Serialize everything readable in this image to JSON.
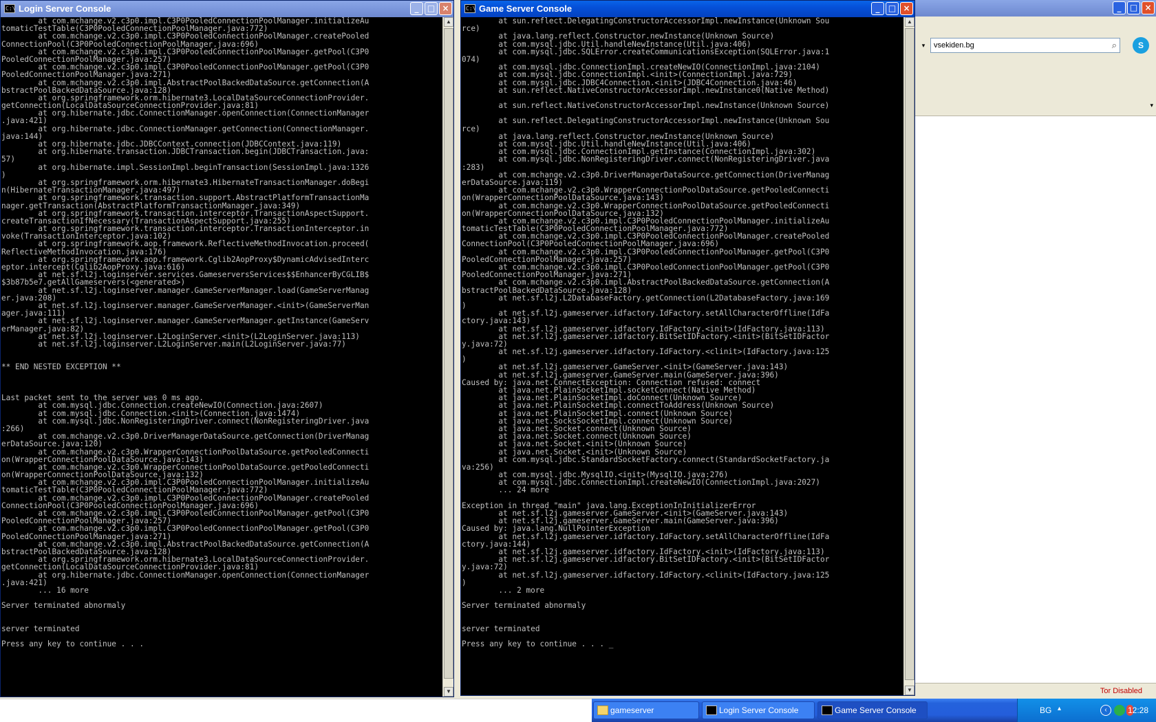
{
  "colors": {
    "title_active": "#0550d8",
    "console_bg": "#000000",
    "console_fg": "#c0c0c0",
    "tor_red": "#c00000"
  },
  "login_window": {
    "title": "Login Server Console",
    "icon": "cmd-icon",
    "lines": [
      "        at com.mchange.v2.c3p0.impl.C3P0PooledConnectionPoolManager.initializeAu",
      "tomaticTestTable(C3P0PooledConnectionPoolManager.java:772)",
      "        at com.mchange.v2.c3p0.impl.C3P0PooledConnectionPoolManager.createPooled",
      "ConnectionPool(C3P0PooledConnectionPoolManager.java:696)",
      "        at com.mchange.v2.c3p0.impl.C3P0PooledConnectionPoolManager.getPool(C3P0",
      "PooledConnectionPoolManager.java:257)",
      "        at com.mchange.v2.c3p0.impl.C3P0PooledConnectionPoolManager.getPool(C3P0",
      "PooledConnectionPoolManager.java:271)",
      "        at com.mchange.v2.c3p0.impl.AbstractPoolBackedDataSource.getConnection(A",
      "bstractPoolBackedDataSource.java:128)",
      "        at org.springframework.orm.hibernate3.LocalDataSourceConnectionProvider.",
      "getConnection(LocalDataSourceConnectionProvider.java:81)",
      "        at org.hibernate.jdbc.ConnectionManager.openConnection(ConnectionManager",
      ".java:421)",
      "        at org.hibernate.jdbc.ConnectionManager.getConnection(ConnectionManager.",
      "java:144)",
      "        at org.hibernate.jdbc.JDBCContext.connection(JDBCContext.java:119)",
      "        at org.hibernate.transaction.JDBCTransaction.begin(JDBCTransaction.java:",
      "57)",
      "        at org.hibernate.impl.SessionImpl.beginTransaction(SessionImpl.java:1326",
      ")",
      "        at org.springframework.orm.hibernate3.HibernateTransactionManager.doBegi",
      "n(HibernateTransactionManager.java:497)",
      "        at org.springframework.transaction.support.AbstractPlatformTransactionMa",
      "nager.getTransaction(AbstractPlatformTransactionManager.java:349)",
      "        at org.springframework.transaction.interceptor.TransactionAspectSupport.",
      "createTransactionIfNecessary(TransactionAspectSupport.java:255)",
      "        at org.springframework.transaction.interceptor.TransactionInterceptor.in",
      "voke(TransactionInterceptor.java:102)",
      "        at org.springframework.aop.framework.ReflectiveMethodInvocation.proceed(",
      "ReflectiveMethodInvocation.java:176)",
      "        at org.springframework.aop.framework.Cglib2AopProxy$DynamicAdvisedInterc",
      "eptor.intercept(Cglib2AopProxy.java:616)",
      "        at net.sf.l2j.loginserver.services.GameserversServices$$EnhancerByCGLIB$",
      "$3b87b5e7.getAllGameservers(<generated>)",
      "        at net.sf.l2j.loginserver.manager.GameServerManager.load(GameServerManag",
      "er.java:208)",
      "        at net.sf.l2j.loginserver.manager.GameServerManager.<init>(GameServerMan",
      "ager.java:111)",
      "        at net.sf.l2j.loginserver.manager.GameServerManager.getInstance(GameServ",
      "erManager.java:82)",
      "        at net.sf.l2j.loginserver.L2LoginServer.<init>(L2LoginServer.java:113)",
      "        at net.sf.l2j.loginserver.L2LoginServer.main(L2LoginServer.java:77)",
      "",
      "",
      "** END NESTED EXCEPTION **",
      "",
      "",
      "",
      "Last packet sent to the server was 0 ms ago.",
      "        at com.mysql.jdbc.Connection.createNewIO(Connection.java:2607)",
      "        at com.mysql.jdbc.Connection.<init>(Connection.java:1474)",
      "        at com.mysql.jdbc.NonRegisteringDriver.connect(NonRegisteringDriver.java",
      ":266)",
      "        at com.mchange.v2.c3p0.DriverManagerDataSource.getConnection(DriverManag",
      "erDataSource.java:120)",
      "        at com.mchange.v2.c3p0.WrapperConnectionPoolDataSource.getPooledConnecti",
      "on(WrapperConnectionPoolDataSource.java:143)",
      "        at com.mchange.v2.c3p0.WrapperConnectionPoolDataSource.getPooledConnecti",
      "on(WrapperConnectionPoolDataSource.java:132)",
      "        at com.mchange.v2.c3p0.impl.C3P0PooledConnectionPoolManager.initializeAu",
      "tomaticTestTable(C3P0PooledConnectionPoolManager.java:772)",
      "        at com.mchange.v2.c3p0.impl.C3P0PooledConnectionPoolManager.createPooled",
      "ConnectionPool(C3P0PooledConnectionPoolManager.java:696)",
      "        at com.mchange.v2.c3p0.impl.C3P0PooledConnectionPoolManager.getPool(C3P0",
      "PooledConnectionPoolManager.java:257)",
      "        at com.mchange.v2.c3p0.impl.C3P0PooledConnectionPoolManager.getPool(C3P0",
      "PooledConnectionPoolManager.java:271)",
      "        at com.mchange.v2.c3p0.impl.AbstractPoolBackedDataSource.getConnection(A",
      "bstractPoolBackedDataSource.java:128)",
      "        at org.springframework.orm.hibernate3.LocalDataSourceConnectionProvider.",
      "getConnection(LocalDataSourceConnectionProvider.java:81)",
      "        at org.hibernate.jdbc.ConnectionManager.openConnection(ConnectionManager",
      ".java:421)",
      "        ... 16 more",
      "",
      "Server terminated abnormaly",
      "",
      "",
      "server terminated",
      "",
      "Press any key to continue . . ."
    ]
  },
  "game_window": {
    "title": "Game Server Console",
    "icon": "cmd-icon",
    "lines": [
      "        at sun.reflect.DelegatingConstructorAccessorImpl.newInstance(Unknown Sou",
      "rce)",
      "        at java.lang.reflect.Constructor.newInstance(Unknown Source)",
      "        at com.mysql.jdbc.Util.handleNewInstance(Util.java:406)",
      "        at com.mysql.jdbc.SQLError.createCommunicationsException(SQLError.java:1",
      "074)",
      "        at com.mysql.jdbc.ConnectionImpl.createNewIO(ConnectionImpl.java:2104)",
      "        at com.mysql.jdbc.ConnectionImpl.<init>(ConnectionImpl.java:729)",
      "        at com.mysql.jdbc.JDBC4Connection.<init>(JDBC4Connection.java:46)",
      "        at sun.reflect.NativeConstructorAccessorImpl.newInstance0(Native Method)",
      "",
      "        at sun.reflect.NativeConstructorAccessorImpl.newInstance(Unknown Source)",
      "",
      "        at sun.reflect.DelegatingConstructorAccessorImpl.newInstance(Unknown Sou",
      "rce)",
      "        at java.lang.reflect.Constructor.newInstance(Unknown Source)",
      "        at com.mysql.jdbc.Util.handleNewInstance(Util.java:406)",
      "        at com.mysql.jdbc.ConnectionImpl.getInstance(ConnectionImpl.java:302)",
      "        at com.mysql.jdbc.NonRegisteringDriver.connect(NonRegisteringDriver.java",
      ":283)",
      "        at com.mchange.v2.c3p0.DriverManagerDataSource.getConnection(DriverManag",
      "erDataSource.java:119)",
      "        at com.mchange.v2.c3p0.WrapperConnectionPoolDataSource.getPooledConnecti",
      "on(WrapperConnectionPoolDataSource.java:143)",
      "        at com.mchange.v2.c3p0.WrapperConnectionPoolDataSource.getPooledConnecti",
      "on(WrapperConnectionPoolDataSource.java:132)",
      "        at com.mchange.v2.c3p0.impl.C3P0PooledConnectionPoolManager.initializeAu",
      "tomaticTestTable(C3P0PooledConnectionPoolManager.java:772)",
      "        at com.mchange.v2.c3p0.impl.C3P0PooledConnectionPoolManager.createPooled",
      "ConnectionPool(C3P0PooledConnectionPoolManager.java:696)",
      "        at com.mchange.v2.c3p0.impl.C3P0PooledConnectionPoolManager.getPool(C3P0",
      "PooledConnectionPoolManager.java:257)",
      "        at com.mchange.v2.c3p0.impl.C3P0PooledConnectionPoolManager.getPool(C3P0",
      "PooledConnectionPoolManager.java:271)",
      "        at com.mchange.v2.c3p0.impl.AbstractPoolBackedDataSource.getConnection(A",
      "bstractPoolBackedDataSource.java:128)",
      "        at net.sf.l2j.L2DatabaseFactory.getConnection(L2DatabaseFactory.java:169",
      ")",
      "        at net.sf.l2j.gameserver.idfactory.IdFactory.setAllCharacterOffline(IdFa",
      "ctory.java:143)",
      "        at net.sf.l2j.gameserver.idfactory.IdFactory.<init>(IdFactory.java:113)",
      "        at net.sf.l2j.gameserver.idfactory.BitSetIDFactory.<init>(BitSetIDFactor",
      "y.java:72)",
      "        at net.sf.l2j.gameserver.idfactory.IdFactory.<clinit>(IdFactory.java:125",
      ")",
      "        at net.sf.l2j.gameserver.GameServer.<init>(GameServer.java:143)",
      "        at net.sf.l2j.gameserver.GameServer.main(GameServer.java:396)",
      "Caused by: java.net.ConnectException: Connection refused: connect",
      "        at java.net.PlainSocketImpl.socketConnect(Native Method)",
      "        at java.net.PlainSocketImpl.doConnect(Unknown Source)",
      "        at java.net.PlainSocketImpl.connectToAddress(Unknown Source)",
      "        at java.net.PlainSocketImpl.connect(Unknown Source)",
      "        at java.net.SocksSocketImpl.connect(Unknown Source)",
      "        at java.net.Socket.connect(Unknown Source)",
      "        at java.net.Socket.connect(Unknown Source)",
      "        at java.net.Socket.<init>(Unknown Source)",
      "        at java.net.Socket.<init>(Unknown Source)",
      "        at com.mysql.jdbc.StandardSocketFactory.connect(StandardSocketFactory.ja",
      "va:256)",
      "        at com.mysql.jdbc.MysqlIO.<init>(MysqlIO.java:276)",
      "        at com.mysql.jdbc.ConnectionImpl.createNewIO(ConnectionImpl.java:2027)",
      "        ... 24 more",
      "",
      "Exception in thread \"main\" java.lang.ExceptionInInitializerError",
      "        at net.sf.l2j.gameserver.GameServer.<init>(GameServer.java:143)",
      "        at net.sf.l2j.gameserver.GameServer.main(GameServer.java:396)",
      "Caused by: java.lang.NullPointerException",
      "        at net.sf.l2j.gameserver.idfactory.IdFactory.setAllCharacterOffline(IdFa",
      "ctory.java:144)",
      "        at net.sf.l2j.gameserver.idfactory.IdFactory.<init>(IdFactory.java:113)",
      "        at net.sf.l2j.gameserver.idfactory.BitSetIDFactory.<init>(BitSetIDFactor",
      "y.java:72)",
      "        at net.sf.l2j.gameserver.idfactory.IdFactory.<clinit>(IdFactory.java:125",
      ")",
      "        ... 2 more",
      "",
      "Server terminated abnormaly",
      "",
      "",
      "server terminated",
      "",
      "Press any key to continue . . . _"
    ]
  },
  "browser": {
    "search_value": "vsekiden.bg",
    "status_tor": "Tor Disabled"
  },
  "taskbar": {
    "tasks": [
      {
        "label": "gameserver",
        "icon": "folder-icon"
      },
      {
        "label": "Login Server Console",
        "icon": "cmd-icon"
      },
      {
        "label": "Game Server Console",
        "icon": "cmd-icon"
      }
    ],
    "language": "BG",
    "clock": "12:28"
  }
}
